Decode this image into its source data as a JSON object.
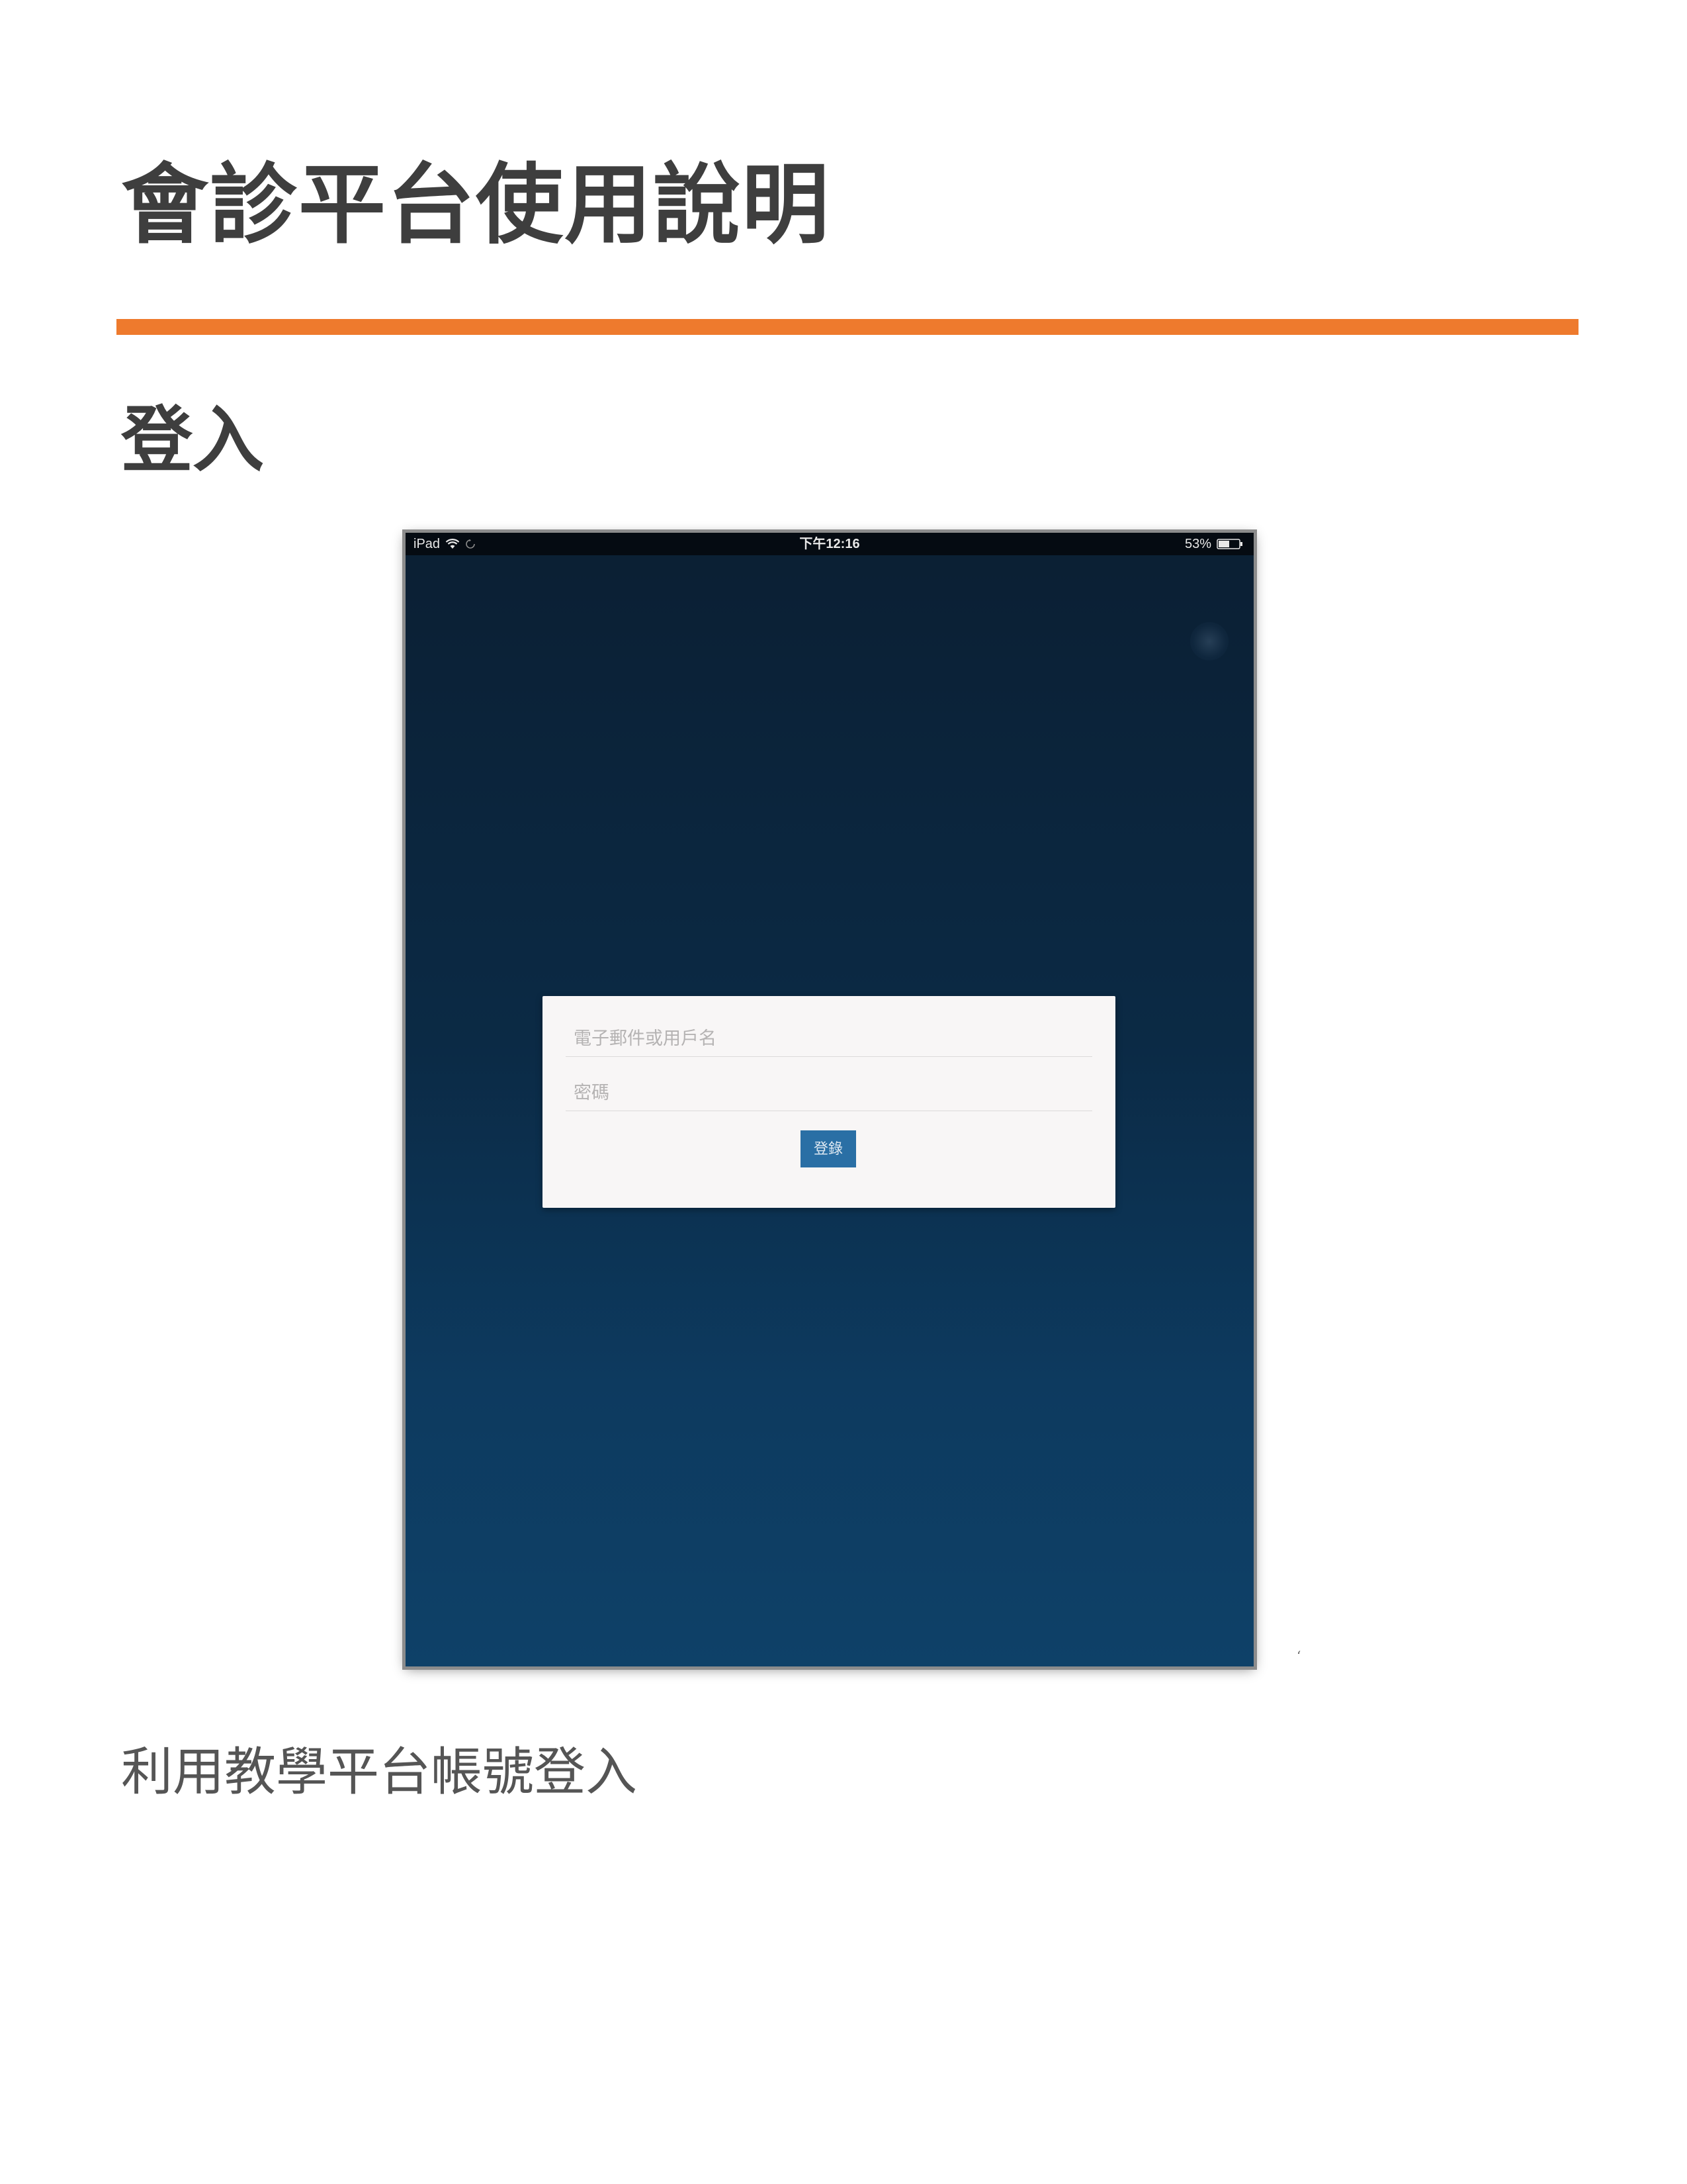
{
  "document": {
    "title": "會診平台使用說明",
    "section_heading": "登入",
    "caption": "利用教學平台帳號登入",
    "stray_mark": "‘"
  },
  "colors": {
    "accent_rule": "#ee7a2d",
    "login_button": "#2a6fa5",
    "screen_bg_top": "#0b1f33",
    "screen_bg_bottom": "#0e4168"
  },
  "device_screenshot": {
    "status_bar": {
      "device": "iPad",
      "time": "下午12:16",
      "battery": "53%",
      "icons": [
        "wifi-icon",
        "rotation-lock-icon",
        "battery-icon"
      ]
    },
    "login_form": {
      "email_placeholder": "電子郵件或用戶名",
      "password_placeholder": "密碼",
      "submit_label": "登錄"
    }
  }
}
